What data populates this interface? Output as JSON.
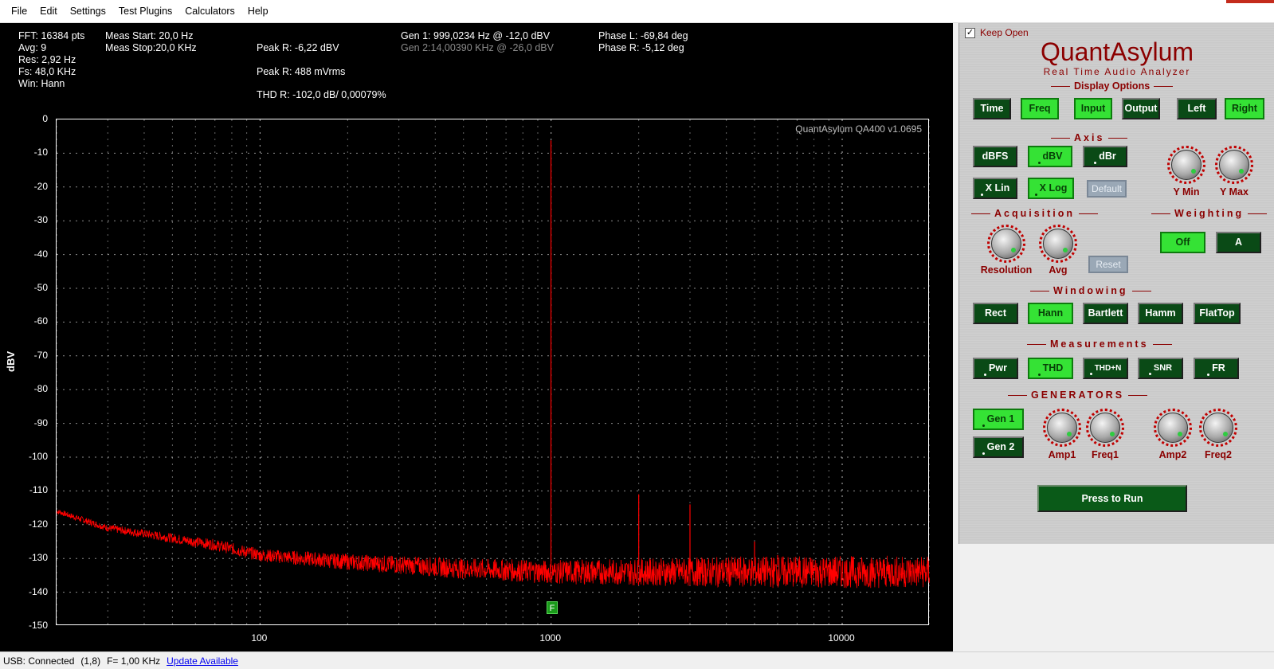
{
  "menu": [
    "File",
    "Edit",
    "Settings",
    "Test Plugins",
    "Calculators",
    "Help"
  ],
  "info": {
    "fft": "FFT: 16384 pts",
    "avg": "Avg: 9",
    "res": "Res: 2,92 Hz",
    "fs": "Fs: 48,0 KHz",
    "win": "Win: Hann",
    "meas_start": "Meas Start: 20,0 Hz",
    "meas_stop": "Meas Stop:20,0 KHz",
    "peak_r_dbv": "Peak R: -6,22 dBV",
    "peak_r_mv": "Peak R: 488 mVrms",
    "thd_r": "THD R: -102,0 dB/ 0,00079%",
    "gen1": "Gen 1: 999,0234 Hz @ -12,0  dBV",
    "gen2": "Gen 2:14,00390 KHz @ -26,0  dBV",
    "phase_l": "Phase L: -69,84 deg",
    "phase_r": "Phase R: -5,12 deg"
  },
  "plot": {
    "watermark": "QuantAsylum QA400 v1.0695",
    "marker": "F"
  },
  "chart_data": {
    "type": "line",
    "xscale": "log",
    "xlim": [
      20,
      20000
    ],
    "ylim": [
      -150,
      0
    ],
    "ylabel": "dBV",
    "xlabel": "",
    "yticks": [
      "0",
      "-10",
      "-20",
      "-30",
      "-40",
      "-50",
      "-60",
      "-70",
      "-80",
      "-90",
      "-100",
      "-110",
      "-120",
      "-130",
      "-140",
      "-150"
    ],
    "xticks": [
      {
        "value": 100,
        "label": "100"
      },
      {
        "value": 1000,
        "label": "1000"
      },
      {
        "value": 10000,
        "label": "10000"
      }
    ],
    "grid": true,
    "color": "#ff0000",
    "series": [
      {
        "noise_floor": [
          [
            20,
            -116
          ],
          [
            30,
            -121
          ],
          [
            50,
            -124
          ],
          [
            70,
            -126
          ],
          [
            100,
            -129
          ],
          [
            200,
            -131
          ],
          [
            500,
            -133
          ],
          [
            1000,
            -134
          ],
          [
            5000,
            -134
          ],
          [
            20000,
            -134
          ]
        ],
        "peaks": [
          {
            "x": 999,
            "y": -6.2
          },
          {
            "x": 2000,
            "y": -111
          },
          {
            "x": 3000,
            "y": -114
          },
          {
            "x": 5000,
            "y": -125
          },
          {
            "x": 6000,
            "y": -129
          }
        ]
      }
    ]
  },
  "panel": {
    "keep_open": "Keep Open",
    "brand": "QuantAsylum",
    "brand_sub": "Real Time Audio Analyzer",
    "display_options": "Display Options",
    "btn_time": "Time",
    "btn_freq": "Freq",
    "btn_input": "Input",
    "btn_output": "Output",
    "btn_left": "Left",
    "btn_right": "Right",
    "axis": "Axis",
    "btn_dbfs": "dBFS",
    "btn_dbv": "dBV",
    "btn_dbr": "dBr",
    "btn_xlin": "X Lin",
    "btn_xlog": "X Log",
    "btn_default": "Default",
    "knob_ymin": "Y Min",
    "knob_ymax": "Y Max",
    "acquisition": "Acquisition",
    "weighting": "Weighting",
    "knob_resolution": "Resolution",
    "knob_avg": "Avg",
    "btn_reset": "Reset",
    "btn_off": "Off",
    "btn_a": "A",
    "windowing": "Windowing",
    "btn_rect": "Rect",
    "btn_hann": "Hann",
    "btn_bartlett": "Bartlett",
    "btn_hamm": "Hamm",
    "btn_flattop": "FlatTop",
    "measurements": "Measurements",
    "btn_pwr": "Pwr",
    "btn_thd": "THD",
    "btn_thdn": "THD+N",
    "btn_snr": "SNR",
    "btn_fr": "FR",
    "generators": "GENERATORS",
    "btn_gen1": "Gen 1",
    "btn_gen2": "Gen 2",
    "knob_amp1": "Amp1",
    "knob_freq1": "Freq1",
    "knob_amp2": "Amp2",
    "knob_freq2": "Freq2",
    "btn_run": "Press to Run"
  },
  "status": {
    "usb": "USB: Connected",
    "code": "(1,8)",
    "freq": "F= 1,00 KHz",
    "update": "Update Available"
  }
}
